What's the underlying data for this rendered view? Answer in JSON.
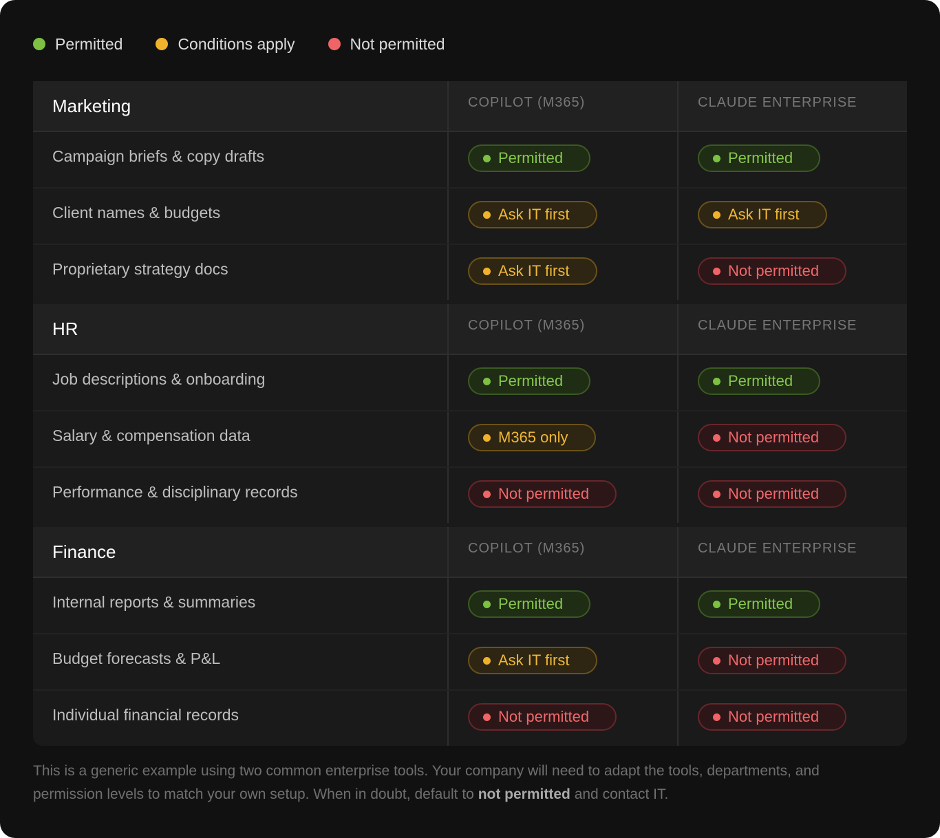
{
  "legend": [
    {
      "label": "Permitted",
      "color": "#7cc142"
    },
    {
      "label": "Conditions apply",
      "color": "#f0b22b"
    },
    {
      "label": "Not permitted",
      "color": "#ef6467"
    }
  ],
  "columns": {
    "tool_a": "COPILOT (M365)",
    "tool_b": "CLAUDE ENTERPRISE"
  },
  "sections": [
    {
      "department": "Marketing",
      "rows": [
        {
          "label": "Campaign briefs & copy drafts",
          "a": {
            "text": "Permitted",
            "status": "ok"
          },
          "b": {
            "text": "Permitted",
            "status": "ok"
          }
        },
        {
          "label": "Client names & budgets",
          "a": {
            "text": "Ask IT first",
            "status": "cond"
          },
          "b": {
            "text": "Ask IT first",
            "status": "cond"
          }
        },
        {
          "label": "Proprietary strategy docs",
          "a": {
            "text": "Ask IT first",
            "status": "cond"
          },
          "b": {
            "text": "Not permitted",
            "status": "no"
          }
        }
      ]
    },
    {
      "department": "HR",
      "rows": [
        {
          "label": "Job descriptions & onboarding",
          "a": {
            "text": "Permitted",
            "status": "ok"
          },
          "b": {
            "text": "Permitted",
            "status": "ok"
          }
        },
        {
          "label": "Salary & compensation data",
          "a": {
            "text": "M365 only",
            "status": "cond"
          },
          "b": {
            "text": "Not permitted",
            "status": "no"
          }
        },
        {
          "label": "Performance & disciplinary records",
          "a": {
            "text": "Not permitted",
            "status": "no"
          },
          "b": {
            "text": "Not permitted",
            "status": "no"
          }
        }
      ]
    },
    {
      "department": "Finance",
      "rows": [
        {
          "label": "Internal reports & summaries",
          "a": {
            "text": "Permitted",
            "status": "ok"
          },
          "b": {
            "text": "Permitted",
            "status": "ok"
          }
        },
        {
          "label": "Budget forecasts & P&L",
          "a": {
            "text": "Ask IT first",
            "status": "cond"
          },
          "b": {
            "text": "Not permitted",
            "status": "no"
          }
        },
        {
          "label": "Individual financial records",
          "a": {
            "text": "Not permitted",
            "status": "no"
          },
          "b": {
            "text": "Not permitted",
            "status": "no"
          }
        }
      ]
    }
  ],
  "footnote": {
    "before": "This is a generic example using two common enterprise tools. Your company will need to adapt the tools, departments, and permission levels to match your own setup. When in doubt, default to ",
    "bold": "not permitted",
    "after": " and contact IT."
  }
}
